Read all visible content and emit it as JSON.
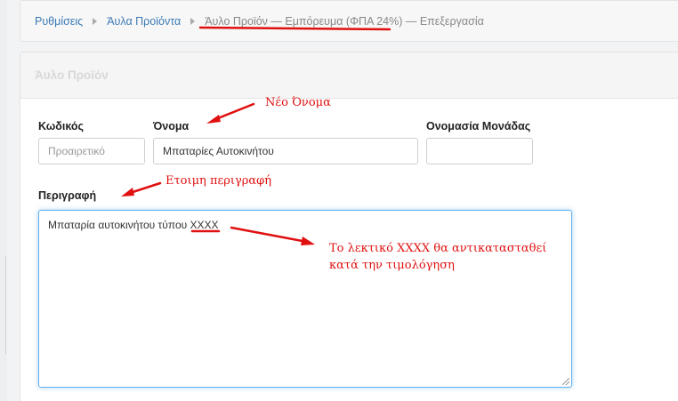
{
  "breadcrumb": {
    "item1": "Ρυθμίσεις",
    "item2": "Άυλα Προϊόντα",
    "current": "Άυλο Προϊόν — Εμπόρευμα (ΦΠΑ 24%) — Επεξεργασία"
  },
  "panel": {
    "title": "Άυλο Προϊόν"
  },
  "form": {
    "code_label": "Κωδικός",
    "code_placeholder": "Προαιρετικό",
    "name_label": "Όνομα",
    "name_value": "Μπαταρίες Αυτοκινήτου",
    "unit_label": "Ονομασία Μονάδας",
    "unit_value": "",
    "description_label": "Περιγραφή",
    "description_value": "Μπαταρία αυτοκινήτου τύπου XXXX"
  },
  "annotations": {
    "new_name": "Νέο Όνομα",
    "ready_description": "Ετοιμη περιγραφή",
    "replace_line1": "Το λεκτικό XXXX θα αντικατασταθεί",
    "replace_line2": "κατά την τιμολόγηση"
  },
  "colors": {
    "annotation": "#e01010",
    "link": "#3c7ab4",
    "focus_border": "#66afe9"
  }
}
